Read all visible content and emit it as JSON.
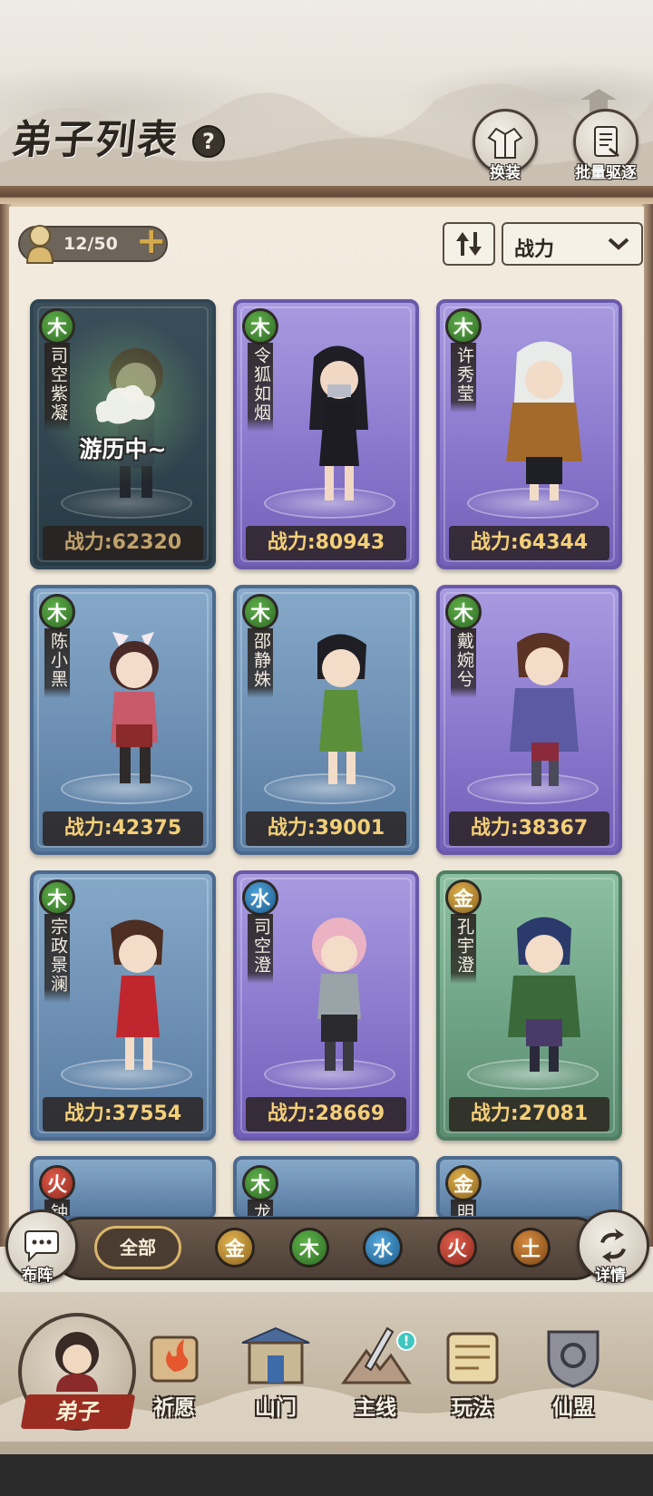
{
  "header": {
    "title": "弟子列表",
    "help_label": "?",
    "buttons": [
      {
        "label": "换装",
        "icon": "robe-icon"
      },
      {
        "label": "批量驱逐",
        "icon": "scroll-icon"
      }
    ]
  },
  "toolbar": {
    "count": "12/50",
    "plus": "+",
    "sort_label": "战力"
  },
  "cards": [
    {
      "element": "木",
      "element_type": "wood",
      "name": "司空紫凝",
      "power": "战力:62320",
      "rarity": "blue",
      "status": "游历中~"
    },
    {
      "element": "木",
      "element_type": "wood",
      "name": "令狐如烟",
      "power": "战力:80943",
      "rarity": "purple"
    },
    {
      "element": "木",
      "element_type": "wood",
      "name": "许秀莹",
      "power": "战力:64344",
      "rarity": "purple"
    },
    {
      "element": "木",
      "element_type": "wood",
      "name": "陈小黑",
      "power": "战力:42375",
      "rarity": "blue"
    },
    {
      "element": "木",
      "element_type": "wood",
      "name": "邵静姝",
      "power": "战力:39001",
      "rarity": "blue"
    },
    {
      "element": "木",
      "element_type": "wood",
      "name": "戴婉兮",
      "power": "战力:38367",
      "rarity": "purple"
    },
    {
      "element": "木",
      "element_type": "wood",
      "name": "宗政景澜",
      "power": "战力:37554",
      "rarity": "blue"
    },
    {
      "element": "水",
      "element_type": "water",
      "name": "司空澄",
      "power": "战力:28669",
      "rarity": "purple"
    },
    {
      "element": "金",
      "element_type": "gold",
      "name": "孔宇澄",
      "power": "战力:27081",
      "rarity": "green"
    },
    {
      "element": "火",
      "element_type": "fire",
      "name": "钟",
      "rarity": "blue"
    },
    {
      "element": "木",
      "element_type": "wood",
      "name": "龙",
      "rarity": "blue"
    },
    {
      "element": "金",
      "element_type": "gold",
      "name": "明",
      "rarity": "blue"
    }
  ],
  "filter": {
    "left_button": "布阵",
    "right_button": "详情",
    "all": "全部",
    "elements": [
      "金",
      "木",
      "水",
      "火",
      "土"
    ]
  },
  "nav": {
    "items": [
      "弟子",
      "祈愿",
      "山门",
      "主线",
      "玩法",
      "仙盟"
    ],
    "badge": "!"
  },
  "colors": {
    "card_blue": "#6c8fb3",
    "card_purple": "#8a78cd",
    "card_green": "#6fa385",
    "power_text": "#f4cf78",
    "active_nav": "#9a2c22"
  }
}
